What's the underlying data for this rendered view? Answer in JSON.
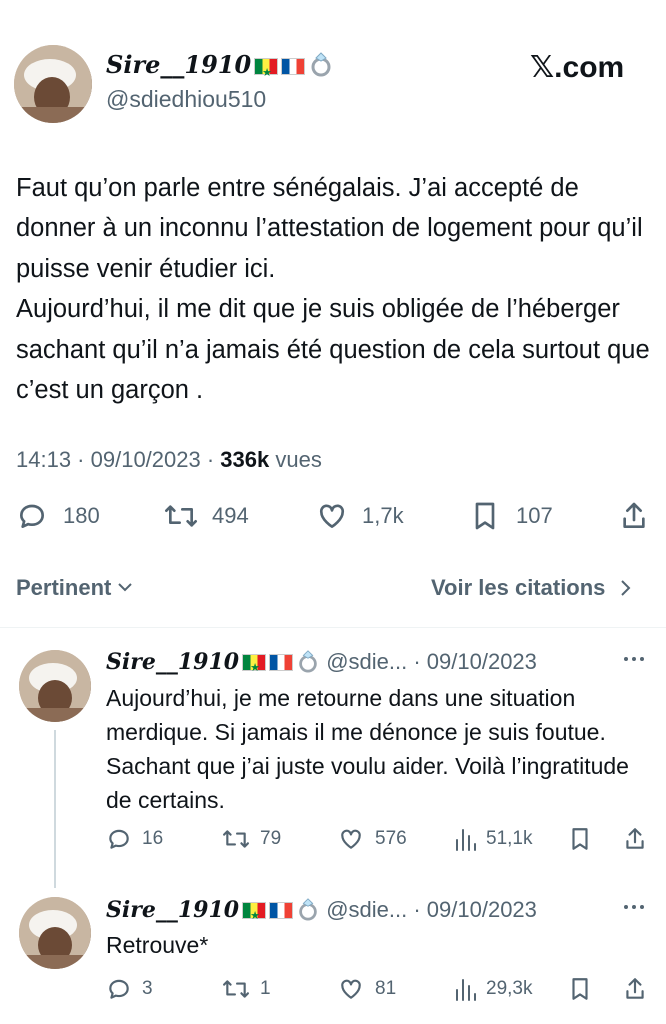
{
  "main_tweet": {
    "display_name": "Sire__1910",
    "handle": "@sdiedhiou510",
    "source": "𝕏.com",
    "text": "Faut qu’on parle entre sénégalais. J’ai accepté de donner à un inconnu l’attestation de logement pour qu’il puisse venir étudier ici.\nAujourd’hui, il me dit que je suis obligée de l’héberger sachant qu’il n’a jamais été question de cela surtout que c’est un garçon .",
    "time": "14:13",
    "date": "09/10/2023",
    "views_count": "336k",
    "views_label": "vues",
    "replies": "180",
    "reposts": "494",
    "likes": "1,7k",
    "bookmarks": "107"
  },
  "sort_bar": {
    "sort_label": "Pertinent",
    "quotes_link": "Voir les citations"
  },
  "replies": [
    {
      "display_name": "Sire__1910",
      "handle": "@sdie...",
      "date": "09/10/2023",
      "text": "Aujourd’hui, je me retourne dans une situation merdique. Si jamais il me dénonce je suis foutue. Sachant que j’ai juste voulu aider. Voilà l’ingratitude de certains.",
      "replies": "16",
      "reposts": "79",
      "likes": "576",
      "views": "51,1k"
    },
    {
      "display_name": "Sire__1910",
      "handle": "@sdie...",
      "date": "09/10/2023",
      "text": "Retrouve*",
      "replies": "3",
      "reposts": "1",
      "likes": "81",
      "views": "29,3k"
    }
  ],
  "colors": {
    "text_primary": "#0f1419",
    "text_secondary": "#536471",
    "divider": "#eff3f4",
    "thread_line": "#cfd9de"
  },
  "icons": [
    "reply-icon",
    "repost-icon",
    "like-icon",
    "bookmark-icon",
    "share-icon",
    "views-icon",
    "more-icon",
    "chevron-down-icon",
    "chevron-right-icon",
    "ring-emoji-icon",
    "senegal-flag-icon",
    "france-flag-icon"
  ]
}
